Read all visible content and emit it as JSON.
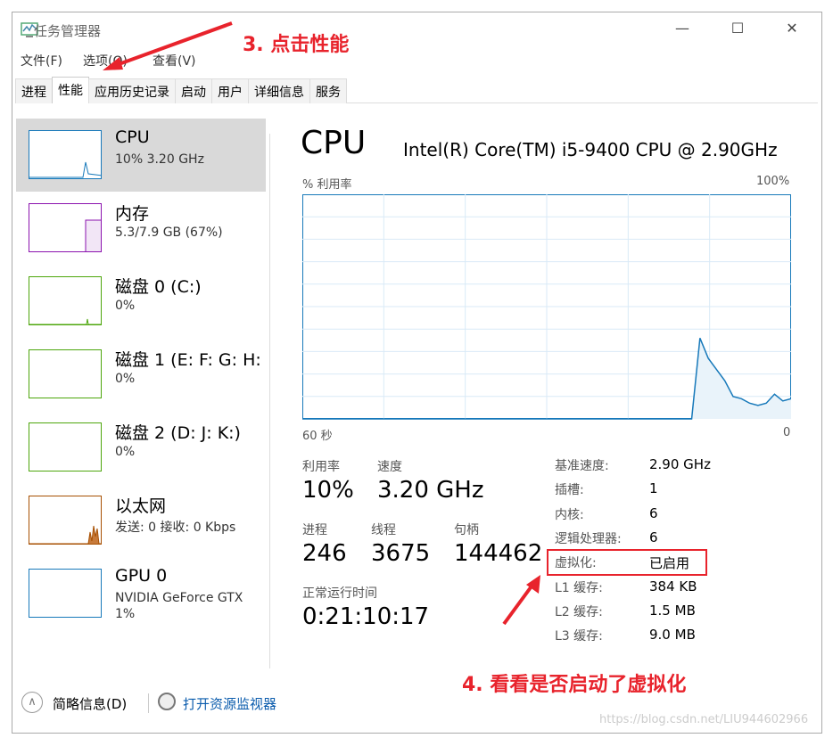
{
  "window": {
    "title": "任务管理器",
    "icon": "task-manager-icon"
  },
  "menu": [
    "文件(F)",
    "选项(O)",
    "查看(V)"
  ],
  "tabs": [
    {
      "label": "进程"
    },
    {
      "label": "性能",
      "active": true
    },
    {
      "label": "应用历史记录"
    },
    {
      "label": "启动"
    },
    {
      "label": "用户"
    },
    {
      "label": "详细信息"
    },
    {
      "label": "服务"
    }
  ],
  "sidebar": [
    {
      "name": "CPU",
      "sub": "10% 3.20 GHz",
      "color": "#1779ba",
      "selected": true
    },
    {
      "name": "内存",
      "sub": "5.3/7.9 GB (67%)",
      "color": "#8b12ae"
    },
    {
      "name": "磁盘 0 (C:)",
      "sub": "0%",
      "color": "#4da60c"
    },
    {
      "name": "磁盘 1 (E: F: G: H:",
      "sub": "0%",
      "color": "#4da60c"
    },
    {
      "name": "磁盘 2 (D: J: K:)",
      "sub": "0%",
      "color": "#4da60c"
    },
    {
      "name": "以太网",
      "sub": "发送: 0 接收: 0 Kbps",
      "color": "#a74f01"
    },
    {
      "name": "GPU 0",
      "sub": "NVIDIA GeForce GTX",
      "sub2": "1%",
      "color": "#1779ba"
    }
  ],
  "main": {
    "title": "CPU",
    "model": "Intel(R) Core(TM) i5-9400 CPU @ 2.90GHz",
    "graph_label": "% 利用率",
    "graph_max": "100%",
    "graph_left": "60 秒",
    "graph_right": "0",
    "utilization_label": "利用率",
    "utilization": "10%",
    "speed_label": "速度",
    "speed": "3.20 GHz",
    "processes_label": "进程",
    "processes": "246",
    "threads_label": "线程",
    "threads": "3675",
    "handles_label": "句柄",
    "handles": "144462",
    "uptime_label": "正常运行时间",
    "uptime": "0:21:10:17",
    "specs": [
      [
        "基准速度:",
        "2.90 GHz"
      ],
      [
        "插槽:",
        "1"
      ],
      [
        "内核:",
        "6"
      ],
      [
        "逻辑处理器:",
        "6"
      ],
      [
        "虚拟化:",
        "已启用"
      ],
      [
        "L1 缓存:",
        "384 KB"
      ],
      [
        "L2 缓存:",
        "1.5 MB"
      ],
      [
        "L3 缓存:",
        "9.0 MB"
      ]
    ],
    "cpu_history_percent": [
      0,
      0,
      0,
      0,
      0,
      0,
      0,
      0,
      0,
      0,
      0,
      0,
      0,
      0,
      0,
      0,
      0,
      0,
      0,
      0,
      0,
      0,
      0,
      0,
      0,
      0,
      0,
      0,
      0,
      0,
      0,
      0,
      0,
      0,
      0,
      0,
      0,
      0,
      0,
      0,
      0,
      0,
      0,
      0,
      0,
      0,
      0,
      0,
      36,
      27,
      22,
      17,
      10,
      9,
      7,
      6,
      7,
      11,
      8,
      9
    ]
  },
  "footer": {
    "summary": "简略信息(D)",
    "resource_monitor": "打开资源监视器"
  },
  "annotations": {
    "step3": "3. 点击性能",
    "step4": "4. 看看是否启动了虚拟化",
    "annotation_color": "#e8232c"
  },
  "watermark": "https://blog.csdn.net/LIU944602966"
}
